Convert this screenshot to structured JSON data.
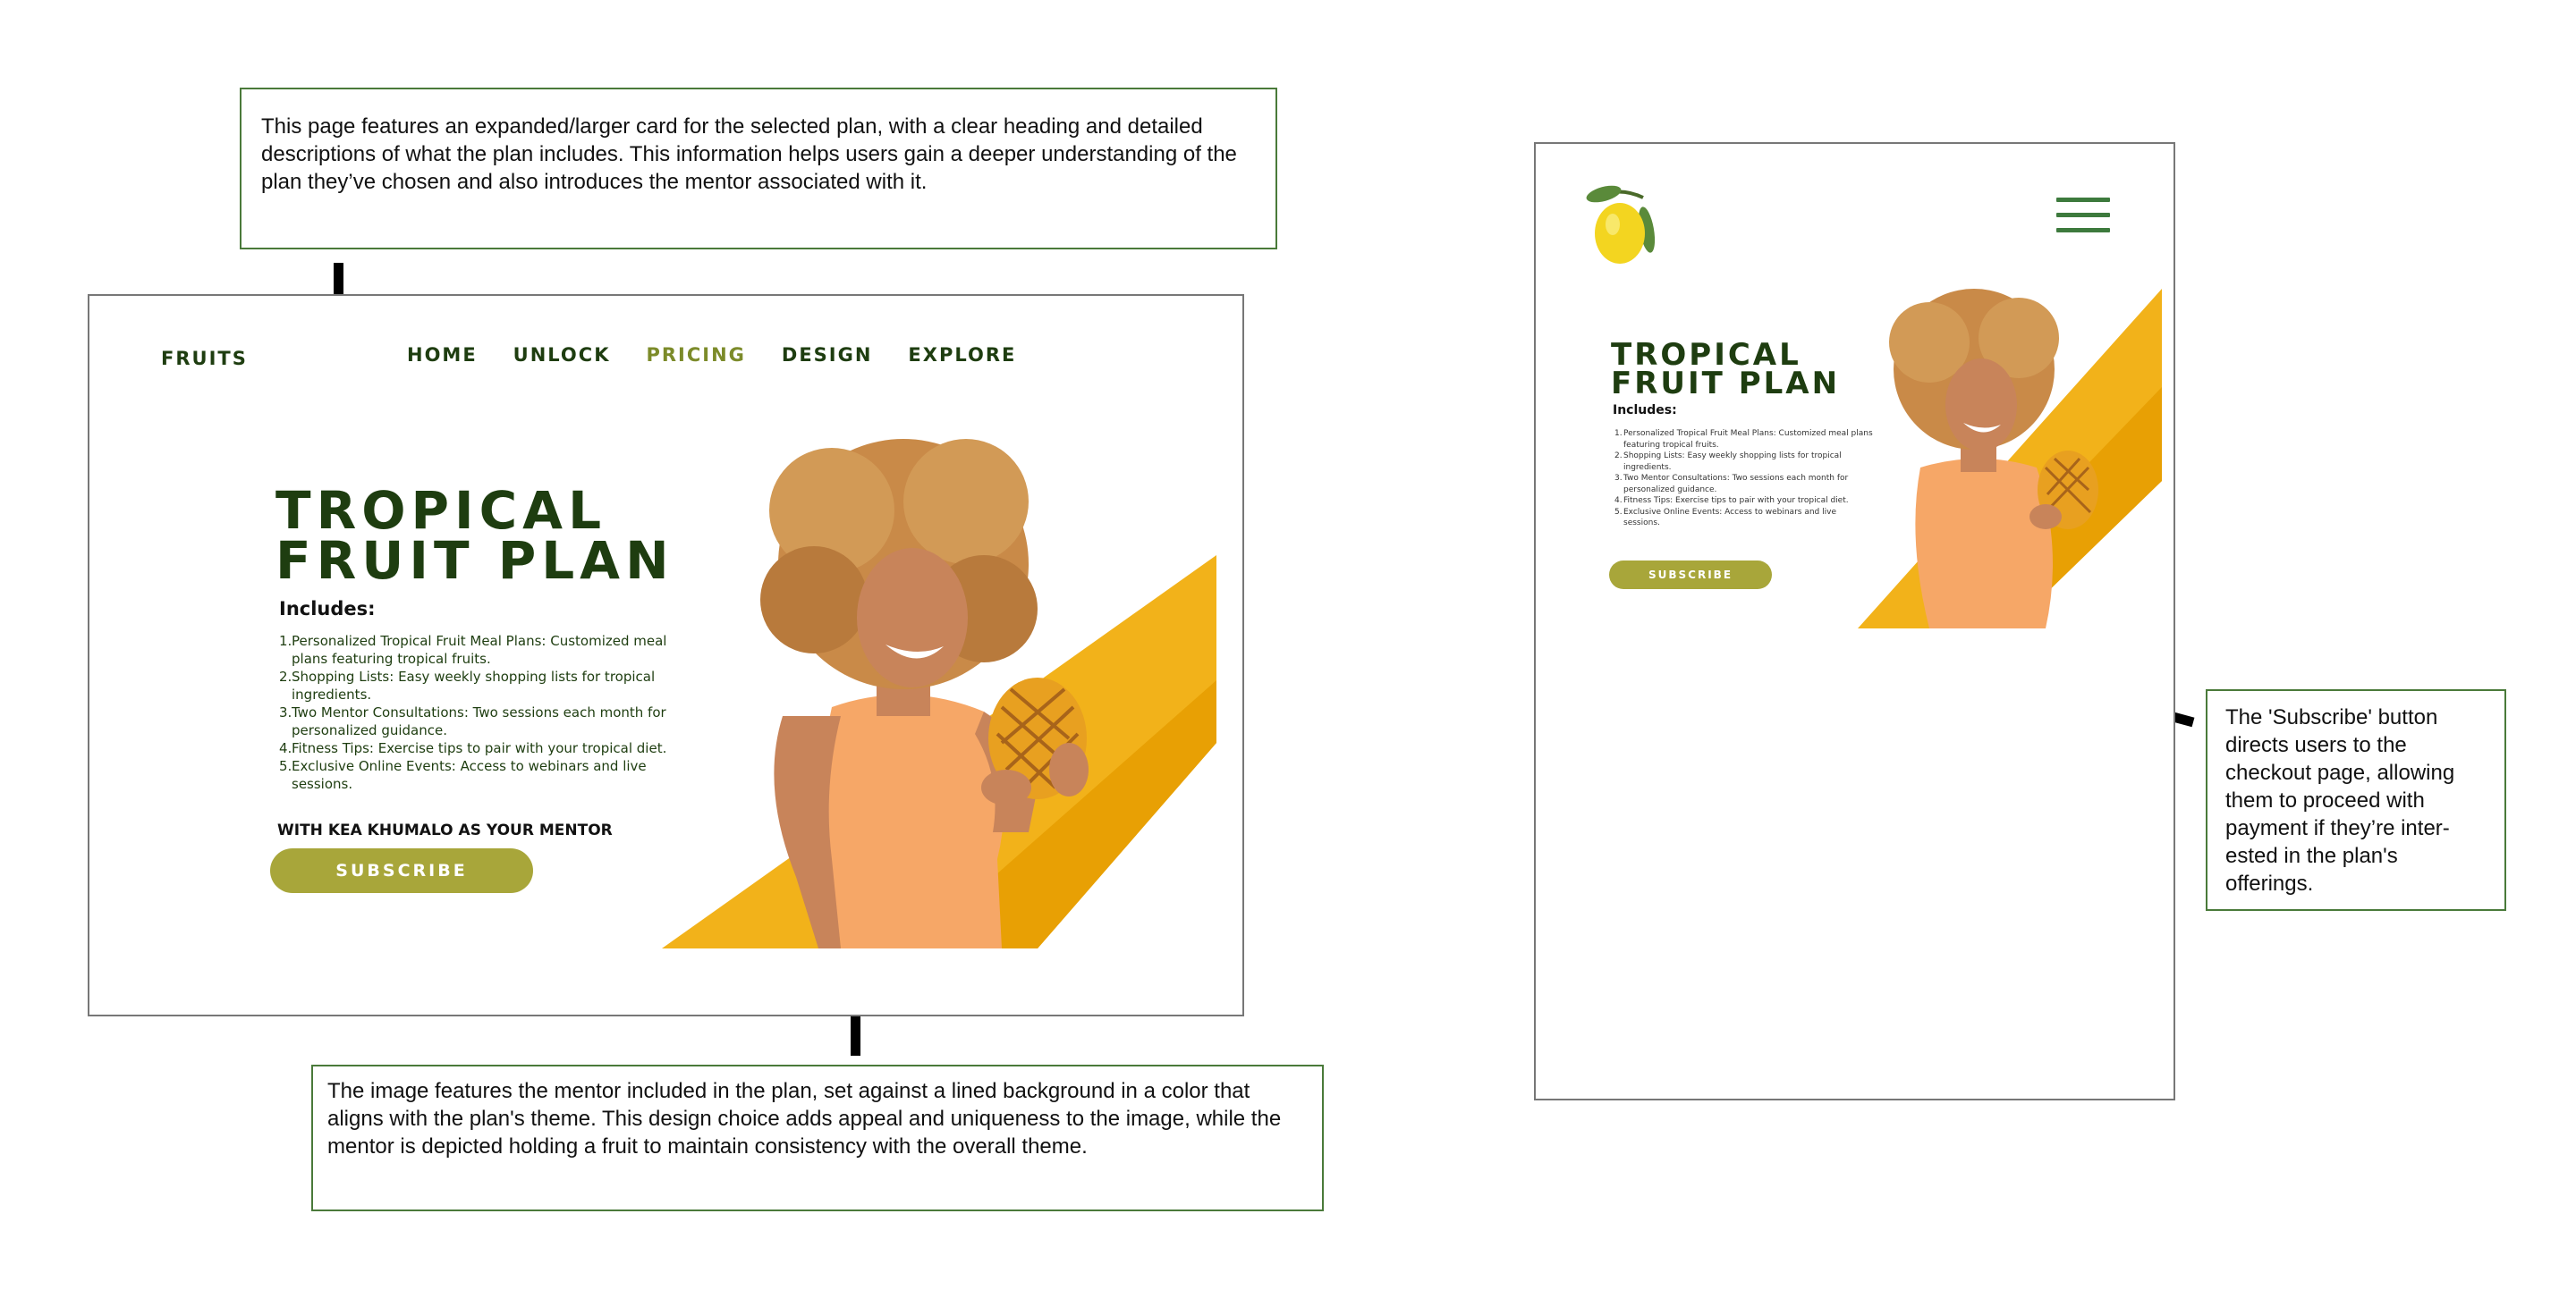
{
  "annotations": {
    "top_note": "This page features an expanded/larger card for the selected plan, with a clear heading and detailed descriptions of what the plan includes. This information helps users gain a deeper understanding of the plan they’ve chosen and also introduces the mentor associated with it.",
    "bottom_note": "The image features the mentor included in the plan, set against a lined background in a color that aligns with the plan's theme. This design choice adds appeal and uniqueness to the image, while the mentor is depicted holding a fruit to maintain consistency with the overall theme.",
    "right_note": "The 'Subscribe' button directs users to the checkout page, allowing them to proceed with payment if they’re inter-ested in the plan's offerings."
  },
  "desktop": {
    "logo": "FRUITS",
    "nav": [
      "HOME",
      "UNLOCK",
      "PRICING",
      "DESIGN",
      "EXPLORE"
    ],
    "active_nav": "PRICING",
    "title_line1": "TROPICAL",
    "title_line2": "FRUIT PLAN",
    "includes_label": "Includes:",
    "items": [
      "Personalized Tropical Fruit Meal Plans: Customized meal plans featuring tropical fruits.",
      "Shopping Lists: Easy weekly shopping lists for tropical ingredients.",
      "Two Mentor Consultations: Two sessions each month for personalized guidance.",
      "Fitness Tips: Exercise tips to pair with your tropical diet.",
      "Exclusive Online Events: Access to webinars and live sessions."
    ],
    "mentor_line": "WITH KEA KHUMALO AS YOUR MENTOR",
    "subscribe_label": "SUBSCRIBE"
  },
  "mobile": {
    "title_line1": "TROPICAL",
    "title_line2": "FRUIT PLAN",
    "includes_label": "Includes:",
    "items": [
      "Personalized Tropical Fruit Meal Plans: Customized meal plans featuring tropical fruits.",
      "Shopping Lists: Easy weekly shopping lists for tropical ingredients.",
      "Two Mentor Consultations: Two sessions each month for personalized guidance.",
      "Fitness Tips: Exercise tips to pair with your tropical diet.",
      "Exclusive Online Events: Access to webinars and live sessions."
    ],
    "subscribe_label": "SUBSCRIBE"
  },
  "colors": {
    "dark_green": "#1e3d10",
    "active_nav": "#7c8b2a",
    "button": "#a8a63a",
    "stripe_light": "#f0b01a",
    "stripe_dark": "#e8a000",
    "note_border": "#4a7a3a",
    "menu_icon": "#3d7a3d"
  }
}
